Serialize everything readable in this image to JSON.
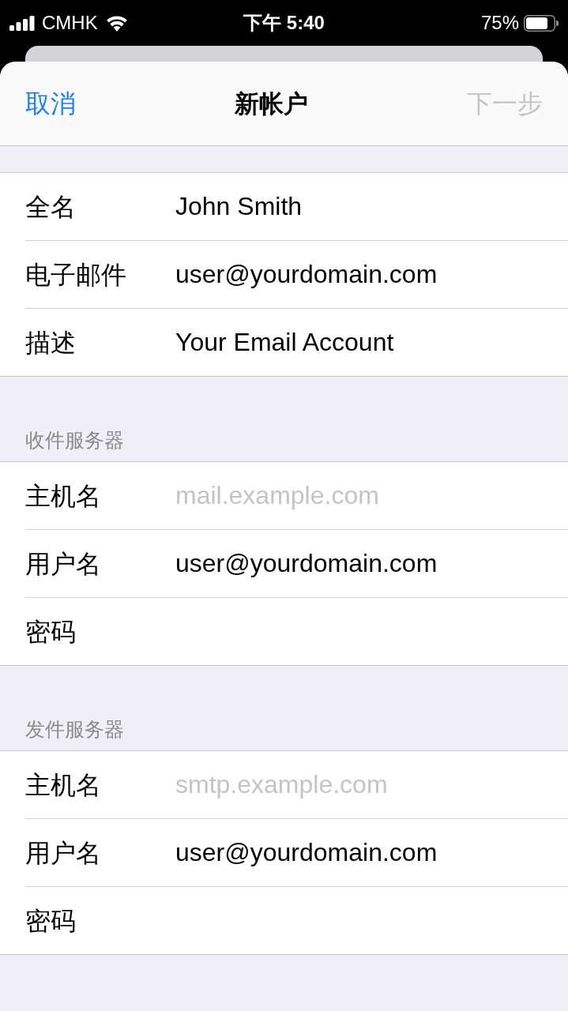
{
  "status_bar": {
    "carrier": "CMHK",
    "time": "下午 5:40",
    "battery": "75%"
  },
  "nav_bar": {
    "cancel": "取消",
    "title": "新帐户",
    "next": {
      "label": "下一步",
      "disabled": true
    }
  },
  "sections": [
    {
      "fields": [
        {
          "label": "全名",
          "value": "John Smith"
        },
        {
          "label": "电子邮件",
          "value": "user@yourdomain.com"
        },
        {
          "label": "描述",
          "value": "Your Email Account"
        }
      ]
    },
    {
      "header": "收件服务器",
      "fields": [
        {
          "label": "主机名",
          "placeholder": "mail.example.com"
        },
        {
          "label": "用户名",
          "value": "user@yourdomain.com"
        },
        {
          "label": "密码"
        }
      ]
    },
    {
      "header": "发件服务器",
      "fields": [
        {
          "label": "主机名",
          "placeholder": "smtp.example.com"
        },
        {
          "label": "用户名",
          "value": "user@yourdomain.com"
        },
        {
          "label": "密码"
        }
      ]
    }
  ]
}
